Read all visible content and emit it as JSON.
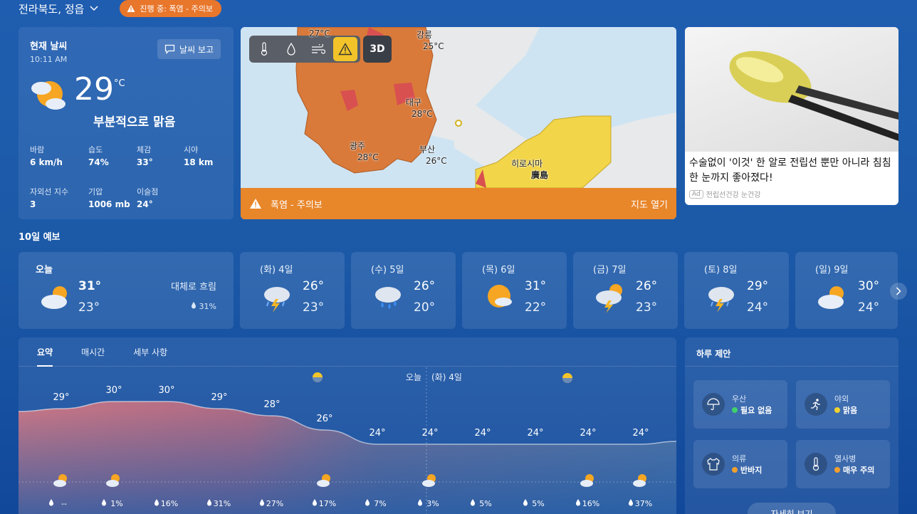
{
  "header": {
    "location": "전라북도, 정읍",
    "alert_pill": "진행 중: 폭염 - 주의보"
  },
  "current": {
    "title": "현재 날씨",
    "time": "10:11 AM",
    "report_button": "날씨 보고",
    "temp": "29",
    "unit": "°C",
    "condition": "부분적으로 맑음",
    "stats": [
      {
        "label": "바람",
        "value": "6 km/h"
      },
      {
        "label": "습도",
        "value": "74%"
      },
      {
        "label": "체감",
        "value": "33°"
      },
      {
        "label": "시야",
        "value": "18 km"
      },
      {
        "label": "자외선 지수",
        "value": "3"
      },
      {
        "label": "기압",
        "value": "1006 mb"
      },
      {
        "label": "이슬점",
        "value": "24°"
      }
    ]
  },
  "map": {
    "toolbar": [
      "thermometer-icon",
      "drop-icon",
      "wind-icon",
      "warning-icon"
    ],
    "three_d": "3D",
    "labels": [
      {
        "name": "27°C",
        "kind": "temp"
      },
      {
        "name": "강릉",
        "kind": "city"
      },
      {
        "name": "25°C",
        "kind": "temp"
      },
      {
        "name": "대구",
        "kind": "city"
      },
      {
        "name": "28°C",
        "kind": "temp"
      },
      {
        "name": "광주",
        "kind": "city"
      },
      {
        "name": "28°C",
        "kind": "temp"
      },
      {
        "name": "부산",
        "kind": "city"
      },
      {
        "name": "26°C",
        "kind": "temp"
      },
      {
        "name": "히로시마",
        "kind": "city"
      },
      {
        "name": "廣島",
        "kind": "city"
      }
    ],
    "alert_text": "폭염 - 주의보",
    "open_map": "지도 열기",
    "colors": {
      "warning": "#e8862a",
      "advisory_fill": "#d97a3a",
      "yellow_fill": "#f2d548",
      "sea": "#cfe4f2"
    }
  },
  "ad": {
    "text": "수술없이 '이것' 한 알로 전립선 뿐만 아니라 침침한 눈까지 좋아졌다!",
    "badge": "Ad",
    "source": "전립선건강 눈건강"
  },
  "forecast": {
    "title": "10일 예보",
    "days": [
      {
        "day": "오늘",
        "hi": "31°",
        "lo": "23°",
        "icon": "partly-cloudy-icon",
        "desc": "대체로 흐림",
        "precip": "31%"
      },
      {
        "day": "(화) 4일",
        "hi": "26°",
        "lo": "23°",
        "icon": "thunderstorm-icon"
      },
      {
        "day": "(수) 5일",
        "hi": "26°",
        "lo": "20°",
        "icon": "rain-icon"
      },
      {
        "day": "(목) 6일",
        "hi": "31°",
        "lo": "22°",
        "icon": "sunny-icon"
      },
      {
        "day": "(금) 7일",
        "hi": "26°",
        "lo": "23°",
        "icon": "sun-thunder-icon"
      },
      {
        "day": "(토) 8일",
        "hi": "29°",
        "lo": "24°",
        "icon": "thunderstorm-icon"
      },
      {
        "day": "(일) 9일",
        "hi": "30°",
        "lo": "24°",
        "icon": "partly-cloudy-icon"
      }
    ]
  },
  "summary": {
    "tabs": [
      "요약",
      "매시간",
      "세부 사항"
    ],
    "today_label": "오늘",
    "next_label": "(화) 4일",
    "hourly_temps": [
      "29°",
      "30°",
      "30°",
      "29°",
      "28°",
      "26°",
      "24°",
      "24°",
      "24°",
      "24°",
      "24°",
      "24°"
    ],
    "hourly_precip": [
      "--",
      "1%",
      "16%",
      "31%",
      "27%",
      "17%",
      "7%",
      "3%",
      "5%",
      "5%",
      "16%",
      "37%"
    ]
  },
  "chart_data": {
    "type": "area",
    "x": [
      "1",
      "2",
      "3",
      "4",
      "5",
      "6",
      "7",
      "8",
      "9",
      "10",
      "11",
      "12"
    ],
    "series": [
      {
        "values": [
          29,
          30,
          30,
          29,
          28,
          26,
          24,
          24,
          24,
          24,
          24,
          24
        ]
      }
    ],
    "ylim": [
      20,
      32
    ]
  },
  "tips": {
    "title": "하루 제안",
    "items": [
      {
        "label": "우산",
        "value": "필요 없음",
        "icon": "umbrella-icon",
        "color": "#3fd26b"
      },
      {
        "label": "야외",
        "value": "맑음",
        "icon": "running-icon",
        "color": "#f2d22e"
      },
      {
        "label": "의류",
        "value": "반바지",
        "icon": "clothing-icon",
        "color": "#f2a02e"
      },
      {
        "label": "열사병",
        "value": "매우 주의",
        "icon": "thermometer-icon",
        "color": "#f2a02e"
      }
    ],
    "more": "자세히 보기"
  }
}
